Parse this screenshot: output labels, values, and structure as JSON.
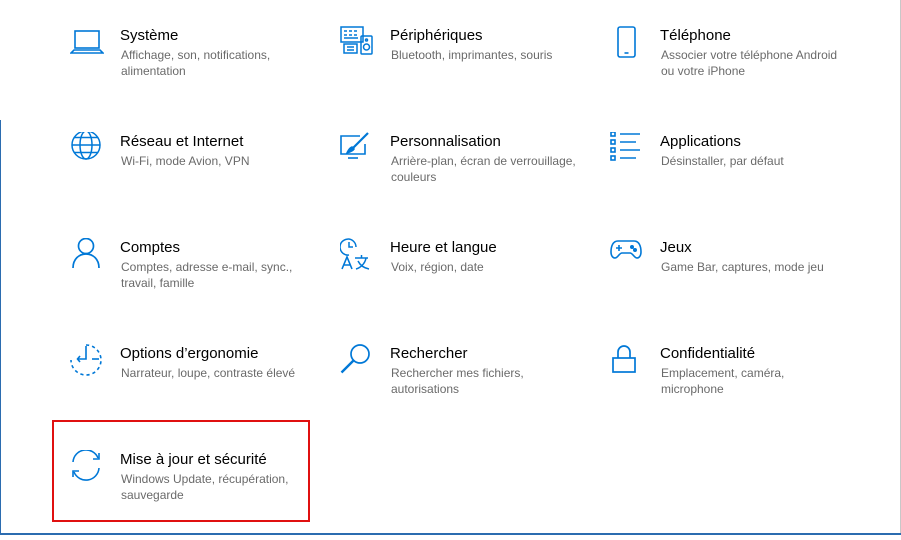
{
  "colors": {
    "accent": "#0078d7",
    "highlight": "#e01010"
  },
  "tiles": [
    {
      "title": "Système",
      "desc": "Affichage, son, notifications, alimentation",
      "icon": "laptop-icon"
    },
    {
      "title": "Périphériques",
      "desc": "Bluetooth, imprimantes, souris",
      "icon": "devices-icon"
    },
    {
      "title": "Téléphone",
      "desc": "Associer votre téléphone Android ou votre iPhone",
      "icon": "phone-icon"
    },
    {
      "title": "Réseau et Internet",
      "desc": "Wi-Fi, mode Avion, VPN",
      "icon": "globe-icon"
    },
    {
      "title": "Personnalisation",
      "desc": "Arrière-plan, écran de verrouillage, couleurs",
      "icon": "paint-icon"
    },
    {
      "title": "Applications",
      "desc": "Désinstaller, par défaut",
      "icon": "apps-list-icon"
    },
    {
      "title": "Comptes",
      "desc": "Comptes, adresse e-mail, sync., travail, famille",
      "icon": "person-icon"
    },
    {
      "title": "Heure et langue",
      "desc": "Voix, région, date",
      "icon": "time-language-icon"
    },
    {
      "title": "Jeux",
      "desc": "Game Bar, captures, mode jeu",
      "icon": "gamepad-icon"
    },
    {
      "title": "Options d’ergonomie",
      "desc": "Narrateur, loupe, contraste élevé",
      "icon": "ease-of-access-icon"
    },
    {
      "title": "Rechercher",
      "desc": "Rechercher mes fichiers, autorisations",
      "icon": "search-icon"
    },
    {
      "title": "Confidentialité",
      "desc": "Emplacement, caméra, microphone",
      "icon": "lock-icon"
    },
    {
      "title": "Mise à jour et sécurité",
      "desc": "Windows Update, récupération, sauvegarde",
      "icon": "sync-icon"
    }
  ]
}
